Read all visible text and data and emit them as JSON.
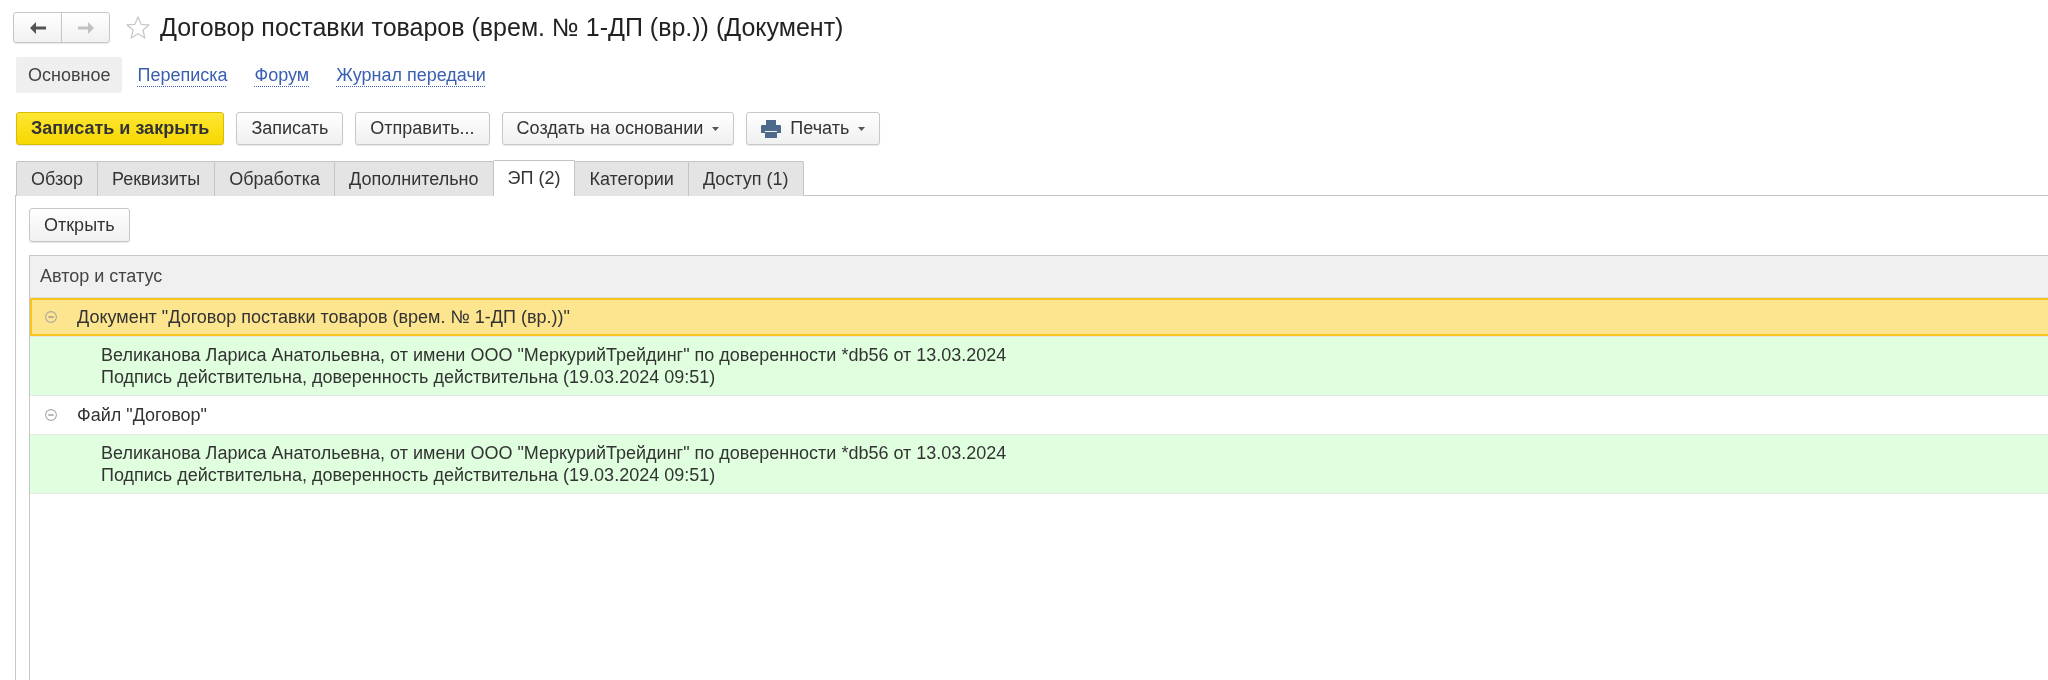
{
  "nav_buttons": [
    {
      "kind": "back",
      "disabled": false
    },
    {
      "kind": "forward",
      "disabled": true
    }
  ],
  "favorite": {
    "on": false
  },
  "title": "Договор поставки товаров (врем. № 1-ДП (вр.)) (Документ)",
  "sections": [
    {
      "label": "Основное",
      "selected": true
    },
    {
      "label": "Переписка",
      "selected": false
    },
    {
      "label": "Форум",
      "selected": false
    },
    {
      "label": "Журнал передачи",
      "selected": false
    }
  ],
  "toolbar": [
    {
      "label": "Записать и закрыть",
      "kind": "primary"
    },
    {
      "label": "Записать",
      "kind": "plain"
    },
    {
      "label": "Отправить...",
      "kind": "plain"
    },
    {
      "label": "Создать на основании",
      "kind": "menu"
    },
    {
      "label": "Печать",
      "kind": "print"
    }
  ],
  "tabs": [
    {
      "label": "Обзор",
      "selected": false
    },
    {
      "label": "Реквизиты",
      "selected": false
    },
    {
      "label": "Обработка",
      "selected": false
    },
    {
      "label": "Дополнительно",
      "selected": false
    },
    {
      "label": "ЭП (2)",
      "selected": true
    },
    {
      "label": "Категории",
      "selected": false
    },
    {
      "label": "Доступ (1)",
      "selected": false
    }
  ],
  "panel": {
    "buttons": [
      {
        "label": "Открыть"
      }
    ],
    "table": {
      "columns": [
        "Автор и статус"
      ],
      "rows": [
        {
          "text": "Документ \"Договор поставки товаров (врем. № 1-ДП (вр.))\"",
          "expanded": true,
          "selected": true,
          "children": [
            {
              "signer": "Великанова Лариса Анатольевна, от имени ООО \"МеркурийТрейдинг\" по доверенности *db56 от 13.03.2024",
              "status": "Подпись действительна, доверенность действительна (19.03.2024 09:51)",
              "valid": true
            }
          ]
        },
        {
          "text": "Файл \"Договор\"",
          "expanded": true,
          "selected": false,
          "children": [
            {
              "signer": "Великанова Лариса Анатольевна, от имени ООО \"МеркурийТрейдинг\" по доверенности *db56 от 13.03.2024",
              "status": "Подпись действительна, доверенность действительна (19.03.2024 09:51)",
              "valid": true
            }
          ]
        }
      ]
    }
  }
}
